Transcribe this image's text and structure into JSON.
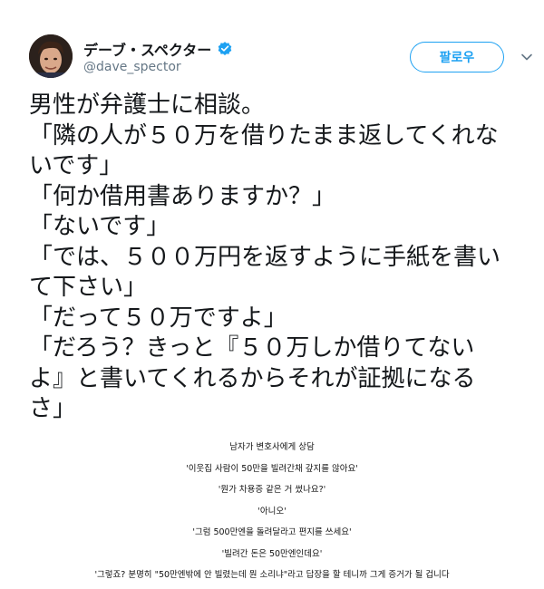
{
  "header": {
    "display_name": "デーブ・スペクター",
    "handle": "@dave_spector",
    "verified_icon": "verified-badge-icon",
    "follow_label": "팔로우",
    "menu_icon": "chevron-down-icon"
  },
  "colors": {
    "accent": "#1da1f2",
    "text": "#14171a",
    "secondary": "#657786"
  },
  "tweet": {
    "lines": [
      "男性が弁護士に相談。",
      "「隣の人が５０万を借りたまま返してくれな",
      "いです」",
      "「何か借用書ありますか？」",
      "「ないです」",
      "「では、５００万円を返すように手紙を書い",
      "て下さい」",
      "「だって５０万ですよ」",
      "「だろう？きっと『５０万しか借りてない",
      "よ』と書いてくれるからそれが証拠になる",
      "さ」"
    ]
  },
  "translation": {
    "lines": [
      "남자가 변호사에게 상담",
      "'이웃집 사람이 50만을 빌려간채 갚지를 않아요'",
      "'뭔가 차용증 같은 거 썼나요?'",
      "'아니오'",
      "'그럼 500만엔을 돌려달라고 편지를 쓰세요'",
      "'빌려간 돈은 50만엔인데요'",
      "'그렇죠? 분명히 \"50만엔밖에 안 빌렸는데 뭔 소리냐\"라고 답장을 할 테니까 그게 증거가 될 겁니다"
    ]
  }
}
